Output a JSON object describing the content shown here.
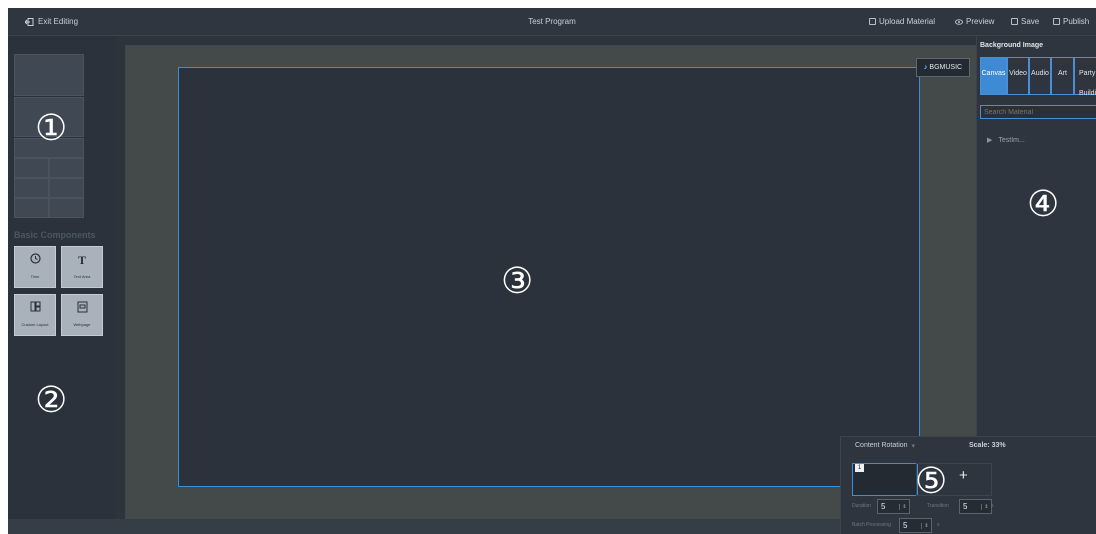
{
  "topbar": {
    "exit_label": "Exit Editing",
    "title": "Test Program",
    "actions": {
      "upload": "Upload Material",
      "preview": "Preview",
      "save": "Save",
      "publish": "Publish"
    }
  },
  "left_panel": {
    "section_title": "Basic Components",
    "components": [
      {
        "label": "Time",
        "icon": "clock-icon"
      },
      {
        "label": "Text Area",
        "icon": "text-icon"
      },
      {
        "label": "Custom Layout",
        "icon": "layout-icon"
      },
      {
        "label": "Webpage",
        "icon": "webpage-icon"
      }
    ]
  },
  "canvas": {
    "bgmusic_label": "BGMUSIC"
  },
  "right_panel": {
    "title": "Background Image",
    "tabs": [
      "Canvas",
      "Video",
      "Audio",
      "Art",
      "Party Building"
    ],
    "search_placeholder": "Search Material",
    "tree_item": "TestIm..."
  },
  "rotation": {
    "title": "Content Rotation",
    "scale_label": "Scale:",
    "scale_value": "33%",
    "thumb_number": "1",
    "duration_label": "Duration",
    "duration_value": "5",
    "transition_label": "Transition",
    "transition_value": "5",
    "batch_label": "Batch Processing",
    "batch_value": "5",
    "unit": "s"
  },
  "badges": [
    "①",
    "②",
    "③",
    "④",
    "⑤"
  ],
  "colors": {
    "accent": "#4a8fd6",
    "panel_bg": "#2b323b",
    "canvas_area": "#434a49"
  }
}
